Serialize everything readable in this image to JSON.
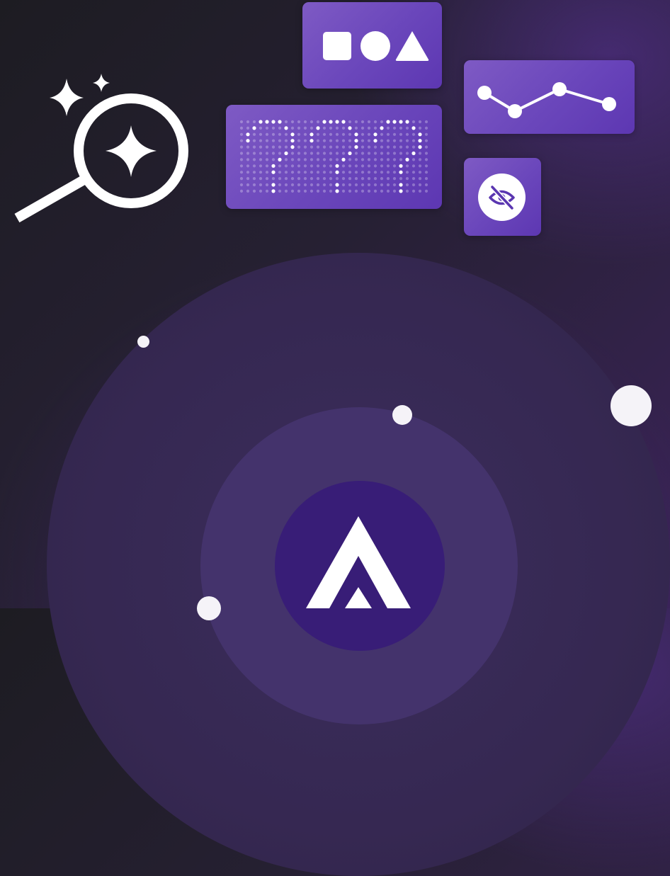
{
  "scene": {
    "colors": {
      "card": "#6a46bb",
      "ring_outer": "#3a2a57",
      "ring_middle": "#45336e",
      "ring_inner": "#3b1f78",
      "foreground": "#ffffff"
    },
    "cards": {
      "shapes": {
        "icons": [
          "square-icon",
          "circle-icon",
          "triangle-icon"
        ]
      },
      "line_graph": {
        "icon": "line-graph-icon"
      },
      "dot_matrix": {
        "icon": "question-marks-icon"
      },
      "hidden": {
        "icon": "eye-slash-icon"
      }
    },
    "search": {
      "icon": "sparkle-magnifier-icon"
    },
    "logo": {
      "icon": "chevron-up-logo"
    }
  }
}
